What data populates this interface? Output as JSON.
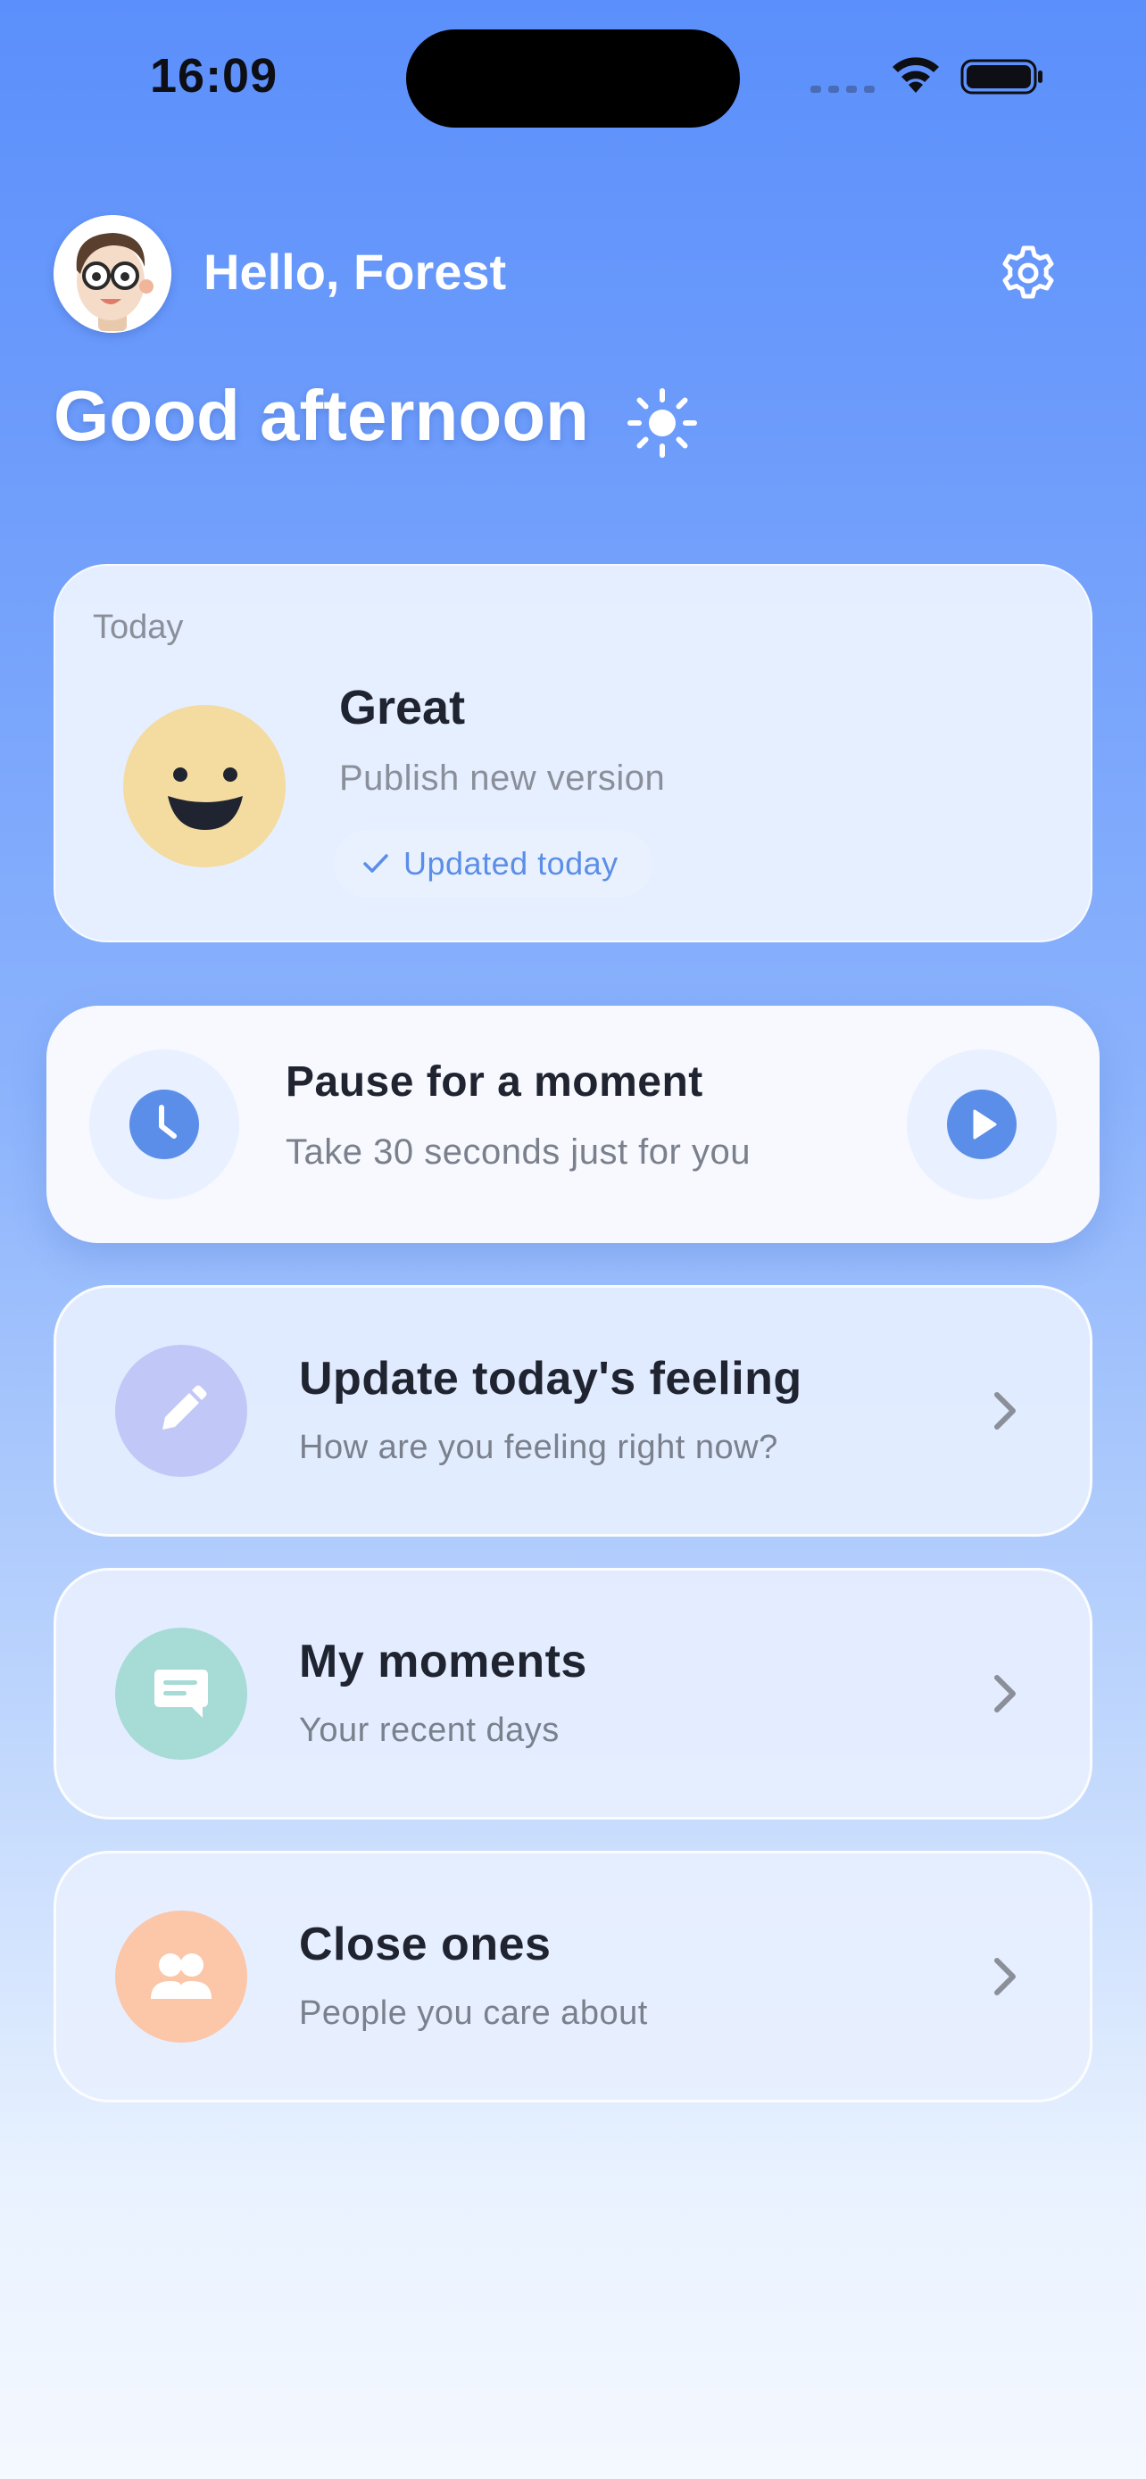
{
  "status_bar": {
    "time": "16:09"
  },
  "header": {
    "greeting_name": "Hello, Forest",
    "greeting_time": "Good afternoon"
  },
  "today_card": {
    "label": "Today",
    "mood": "Great",
    "note": "Publish new version",
    "status": "Updated today"
  },
  "pause_card": {
    "title": "Pause for a moment",
    "subtitle": "Take 30 seconds just for you"
  },
  "actions": [
    {
      "title": "Update today's feeling",
      "subtitle": "How are you feeling right now?",
      "icon": "pencil-icon",
      "color": "#c1c8f7"
    },
    {
      "title": "My moments",
      "subtitle": "Your recent days",
      "icon": "chat-icon",
      "color": "#a6dbd6"
    },
    {
      "title": "Close ones",
      "subtitle": "People you care about",
      "icon": "people-icon",
      "color": "#fcc6a8"
    }
  ],
  "colors": {
    "accent": "#5b8ee8",
    "background_top": "#5b8ffb",
    "background_bottom": "#f4f8ff"
  }
}
